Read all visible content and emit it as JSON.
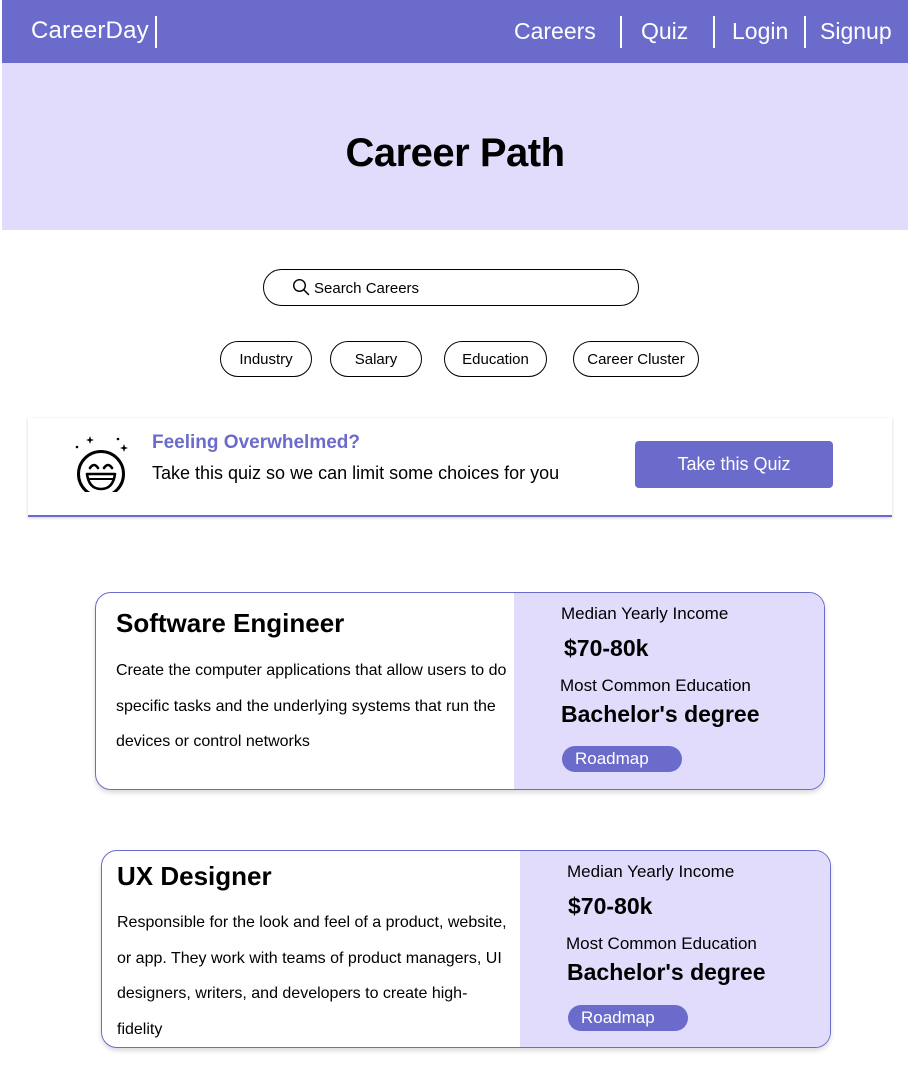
{
  "nav": {
    "brand": "CareerDay",
    "links": [
      "Careers",
      "Quiz",
      "Login",
      "Signup"
    ]
  },
  "hero": {
    "title": "Career Path"
  },
  "search": {
    "placeholder": "Search Careers"
  },
  "filters": [
    "Industry",
    "Salary",
    "Education",
    "Career Cluster"
  ],
  "banner": {
    "title": "Feeling Overwhelmed?",
    "subtitle": "Take this quiz so we can limit some choices for you",
    "button": "Take this Quiz",
    "icon": "smiley-icon"
  },
  "careers": [
    {
      "title": "Software Engineer",
      "description": "Create the computer applications that allow users to do specific tasks and the underlying systems that run the devices or control networks",
      "income_label": "Median Yearly Income",
      "income": "$70-80k",
      "education_label": "Most Common Education",
      "education": "Bachelor's degree",
      "button": "Roadmap"
    },
    {
      "title": "UX Designer",
      "description": "Responsible for the look and feel of a product, website, or app. They work with teams of product managers, UI designers, writers, and developers to create high-fidelity",
      "income_label": "Median Yearly Income",
      "income": "$70-80k",
      "education_label": "Most Common Education",
      "education": "Bachelor's degree",
      "button": "Roadmap"
    }
  ],
  "colors": {
    "primary": "#6b6bcc",
    "accent_light": "#e2dcfc"
  }
}
